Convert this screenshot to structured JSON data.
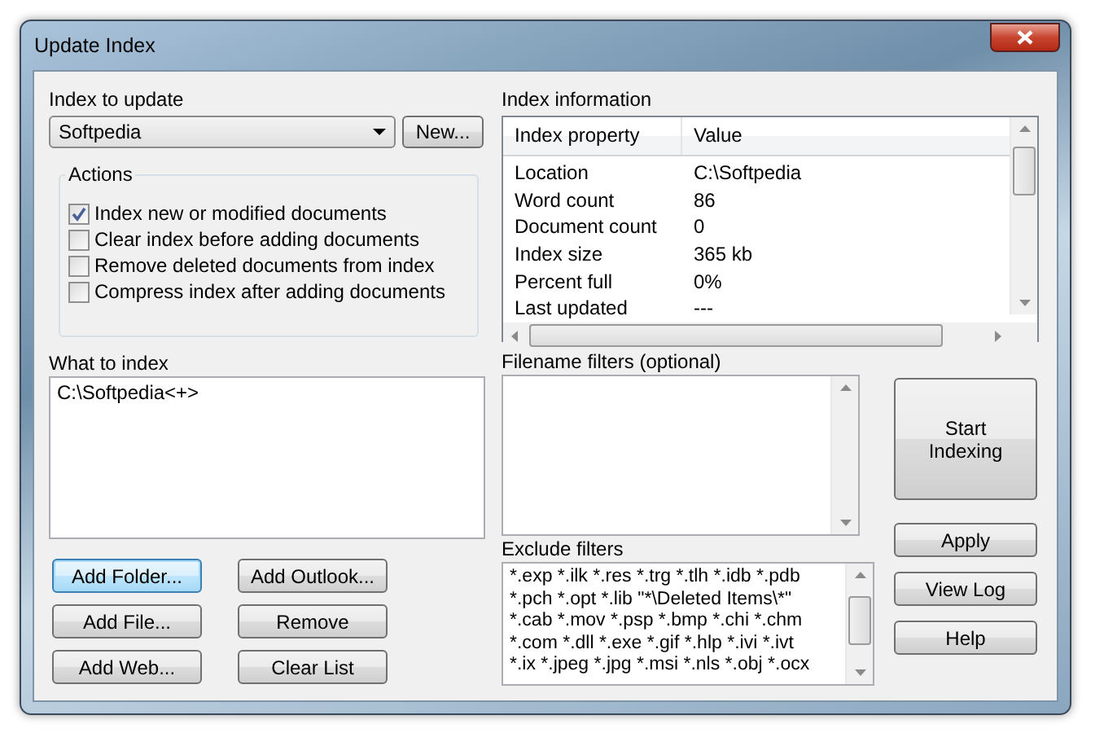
{
  "window": {
    "title": "Update Index"
  },
  "index_to_update": {
    "label": "Index to update",
    "value": "Softpedia",
    "new_button": "New..."
  },
  "actions": {
    "label": "Actions",
    "options": [
      {
        "label": "Index new or modified documents",
        "checked": true
      },
      {
        "label": "Clear index before adding documents",
        "checked": false
      },
      {
        "label": "Remove deleted documents from index",
        "checked": false
      },
      {
        "label": "Compress index after adding documents",
        "checked": false
      }
    ]
  },
  "index_information": {
    "label": "Index information",
    "columns": [
      "Index property",
      "Value"
    ],
    "rows": [
      {
        "property": "Location",
        "value": "C:\\Softpedia"
      },
      {
        "property": "Word count",
        "value": "86"
      },
      {
        "property": "Document count",
        "value": "0"
      },
      {
        "property": "Index size",
        "value": "365 kb"
      },
      {
        "property": "Percent full",
        "value": "0%"
      },
      {
        "property": "Last updated",
        "value": "---"
      }
    ]
  },
  "what_to_index": {
    "label": "What to index",
    "items": [
      "C:\\Softpedia<+>"
    ]
  },
  "list_buttons": [
    {
      "label": "Add Folder...",
      "default": true
    },
    {
      "label": "Add Outlook...",
      "default": false
    },
    {
      "label": "Add File...",
      "default": false
    },
    {
      "label": "Remove",
      "default": false
    },
    {
      "label": "Add Web...",
      "default": false
    },
    {
      "label": "Clear List",
      "default": false
    }
  ],
  "filename_filters": {
    "label": "Filename filters (optional)"
  },
  "exclude_filters": {
    "label": "Exclude filters",
    "lines": [
      "*.exp *.ilk *.res *.trg *.tlh *.idb *.pdb",
      "*.pch *.opt *.lib \"*\\Deleted Items\\*\"",
      "*.cab *.mov *.psp *.bmp *.chi *.chm",
      "*.com *.dll *.exe *.gif *.hlp *.ivi *.ivt",
      "*.ix *.jpeg *.jpg *.msi *.nls *.obj *.ocx"
    ]
  },
  "side_buttons": [
    {
      "label": "Start Indexing",
      "kind": "large"
    },
    {
      "label": "Apply",
      "kind": "normal"
    },
    {
      "label": "View Log",
      "kind": "normal"
    },
    {
      "label": "Help",
      "kind": "normal"
    }
  ]
}
